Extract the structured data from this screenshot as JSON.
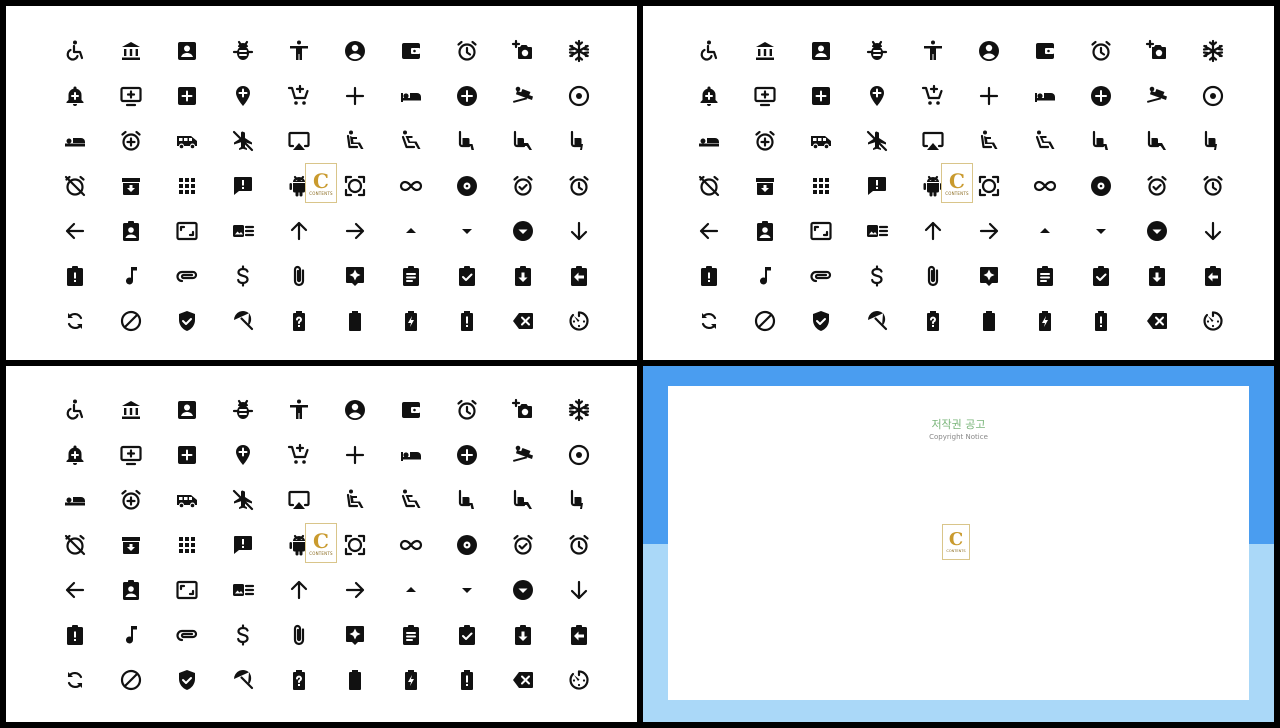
{
  "icons": [
    "accessible-icon",
    "bank-icon",
    "account-box-icon",
    "bug-icon",
    "accessibility-icon",
    "account-circle-icon",
    "wallet-icon",
    "alarm-icon",
    "add-a-photo-icon",
    "snowflake-icon",
    "notification-add-icon",
    "add-to-queue-icon",
    "add-box-icon",
    "add-location-icon",
    "add-shopping-cart-icon",
    "plus-icon",
    "hotel-icon",
    "add-circle-icon",
    "airline-seat-flat-angled-icon",
    "adjust-icon",
    "airline-seat-flat-icon",
    "alarm-add-icon",
    "airport-shuttle-icon",
    "airplanemode-off-icon",
    "airplay-icon",
    "airline-seat-recline-normal-icon",
    "airline-seat-recline-extra-icon",
    "airline-seat-legroom-normal-icon",
    "airline-seat-legroom-extra-icon",
    "airline-seat-legroom-reduced-icon",
    "alarm-off-icon",
    "archive-icon",
    "apps-icon",
    "announcement-icon",
    "android-icon",
    "aspect-ratio-icon",
    "all-inclusive-icon",
    "album-icon",
    "alarm-on-icon",
    "access-alarm-icon",
    "arrow-back-icon",
    "assignment-ind-icon",
    "aspect-ratio-frame-icon",
    "art-track-icon",
    "arrow-upward-icon",
    "arrow-forward-icon",
    "arrow-drop-up-icon",
    "arrow-drop-down-icon",
    "arrow-drop-down-circle-icon",
    "arrow-downward-icon",
    "assignment-late-icon",
    "audiotrack-icon",
    "attachment-icon",
    "attach-money-icon",
    "attach-file-icon",
    "assistant-icon",
    "assignment-icon",
    "assignment-turned-in-icon",
    "assignment-returned-icon",
    "assignment-return-icon",
    "autorenew-icon",
    "block-icon",
    "verified-user-icon",
    "beach-access-icon",
    "battery-unknown-icon",
    "battery-full-icon",
    "battery-charging-icon",
    "battery-alert-icon",
    "backspace-icon",
    "av-timer-icon"
  ],
  "watermark": {
    "letter": "C",
    "text": "CONTENTS"
  },
  "notice": {
    "title": "저작권 공고",
    "subtitle": "Copyright Notice"
  }
}
